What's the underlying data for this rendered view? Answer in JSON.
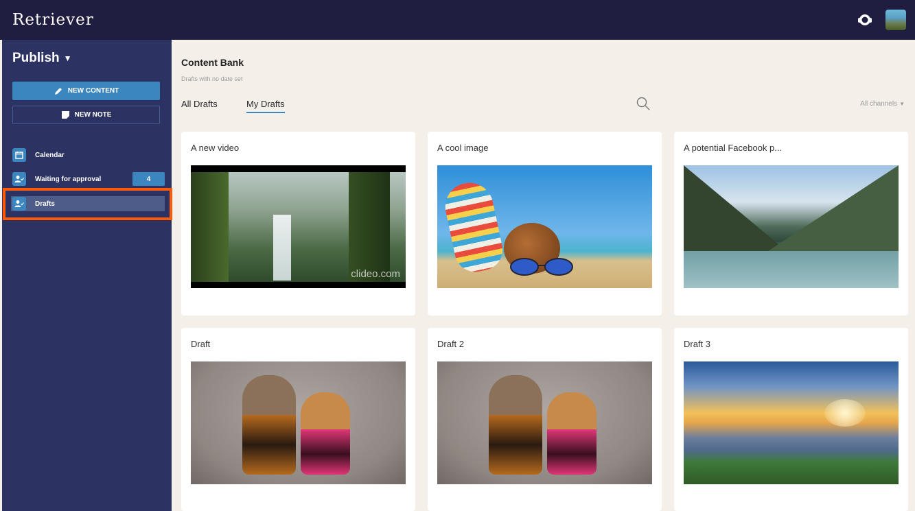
{
  "app": {
    "logo": "Retriever"
  },
  "sidebar": {
    "section": "Publish",
    "new_content_label": "NEW CONTENT",
    "new_note_label": "NEW NOTE",
    "items": [
      {
        "label": "Calendar",
        "icon": "calendar-icon"
      },
      {
        "label": "Waiting for approval",
        "icon": "user-check-icon",
        "badge": "4"
      },
      {
        "label": "Drafts",
        "icon": "user-check-icon",
        "selected": true
      }
    ]
  },
  "main": {
    "title": "Content Bank",
    "subtitle": "Drafts with no date set",
    "tabs": [
      {
        "label": "All Drafts",
        "active": false
      },
      {
        "label": "My Drafts",
        "active": true
      }
    ],
    "channel_filter": "All channels",
    "cards": [
      {
        "title": "A new video",
        "watermark": "clideo.com"
      },
      {
        "title": "A cool image"
      },
      {
        "title": "A potential Facebook p..."
      },
      {
        "title": "Draft"
      },
      {
        "title": "Draft 2"
      },
      {
        "title": "Draft 3"
      }
    ]
  },
  "colors": {
    "topbar": "#1f1d40",
    "sidebar": "#2c3262",
    "accent": "#3c86c0",
    "highlight": "#ff5a0a",
    "background": "#f5efea"
  }
}
